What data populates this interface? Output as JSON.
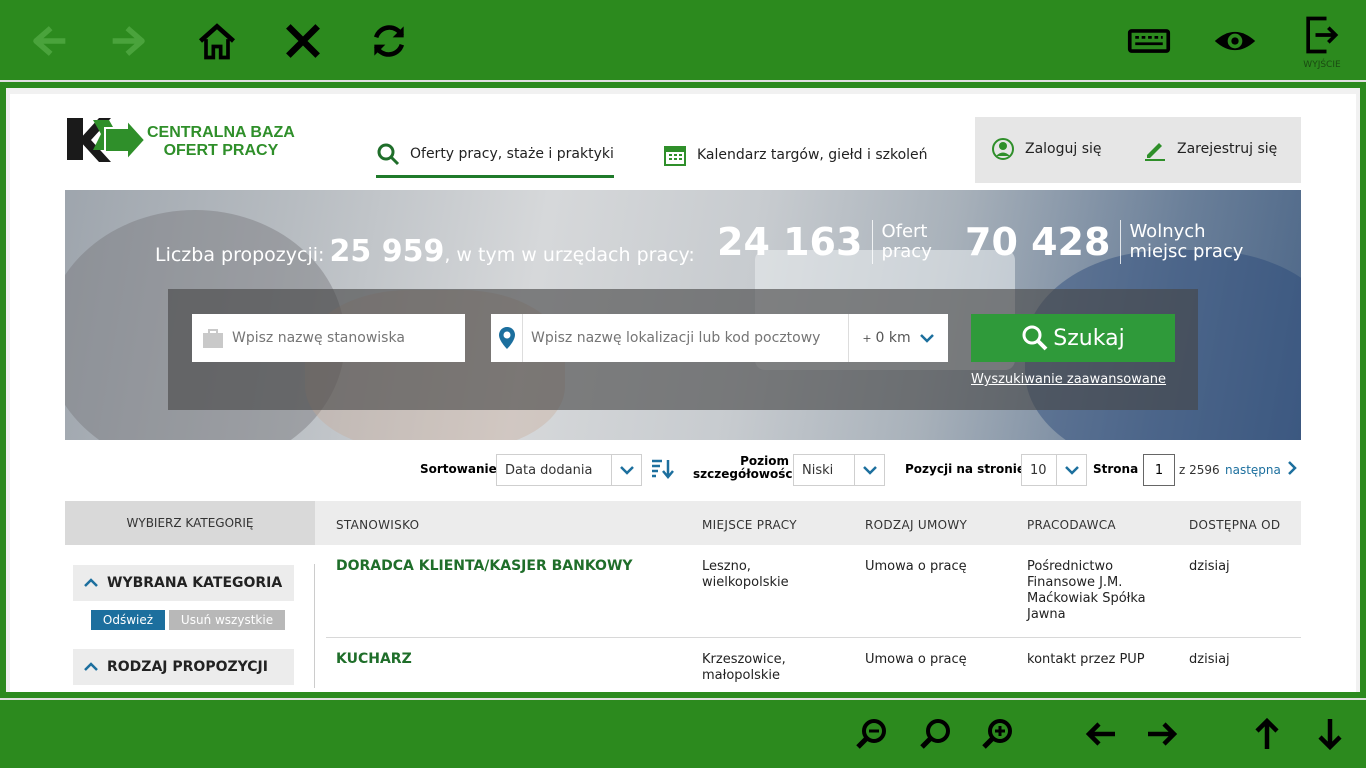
{
  "kiosk": {
    "exit_label": "WYJŚCIE"
  },
  "logo": {
    "line1": "CENTRALNA BAZA",
    "line2": "OFERT PRACY"
  },
  "nav": {
    "offers": "Oferty pracy, staże i praktyki",
    "calendar": "Kalendarz targów, giełd i szkoleń",
    "login": "Zaloguj się",
    "register": "Zarejestruj się"
  },
  "hero": {
    "count_label": "Liczba propozycji:",
    "count_value": "25 959",
    "count_suffix": ", w tym w urzędach pracy:",
    "offers_value": "24 163",
    "offers_label_1": "Ofert",
    "offers_label_2": "pracy",
    "places_value": "70 428",
    "places_label_1": "Wolnych",
    "places_label_2": "miejsc pracy"
  },
  "search": {
    "position_placeholder": "Wpisz nazwę stanowiska",
    "location_placeholder": "Wpisz nazwę lokalizacji lub kod pocztowy",
    "radius_prefix": "+",
    "radius_value": "0 km",
    "button": "Szukaj",
    "advanced": "Wyszukiwanie zaawansowane"
  },
  "sorting": {
    "sort_label": "Sortowanie",
    "sort_value": "Data dodania",
    "detail_label_1": "Poziom",
    "detail_label_2": "szczegółowości",
    "detail_value": "Niski",
    "per_page_label": "Pozycji na stronie",
    "per_page_value": "10",
    "page_label": "Strona",
    "page_value": "1",
    "page_total": "z 2596",
    "next": "następna"
  },
  "table": {
    "category_header": "WYBIERZ KATEGORIĘ",
    "headers": [
      "STANOWISKO",
      "MIEJSCE PRACY",
      "RODZAJ UMOWY",
      "PRACODAWCA",
      "DOSTĘPNA OD"
    ],
    "rows": [
      {
        "position": "DORADCA KLIENTA/KASJER BANKOWY",
        "place_1": "Leszno,",
        "place_2": "wielkopolskie",
        "contract": "Umowa o pracę",
        "employer_1": "Pośrednictwo",
        "employer_2": "Finansowe J.M.",
        "employer_3": "Maćkowiak Spółka",
        "employer_4": "Jawna",
        "available": "dzisiaj"
      },
      {
        "position": "KUCHARZ",
        "place_1": "Krzeszowice,",
        "place_2": "małopolskie",
        "contract": "Umowa o pracę",
        "employer_1": "kontakt przez PUP",
        "available": "dzisiaj"
      }
    ]
  },
  "sidebar": {
    "selected_category": "WYBRANA KATEGORIA",
    "refresh": "Odśwież",
    "clear_all": "Usuń wszystkie",
    "offer_type": "RODZAJ PROPOZYCJI"
  },
  "colors": {
    "kiosk_green": "#2c8a1e",
    "brand_green": "#2f8f2a",
    "title_green": "#1f6e2a",
    "button_green": "#2f9a3a",
    "link_blue": "#1c6f9e"
  }
}
